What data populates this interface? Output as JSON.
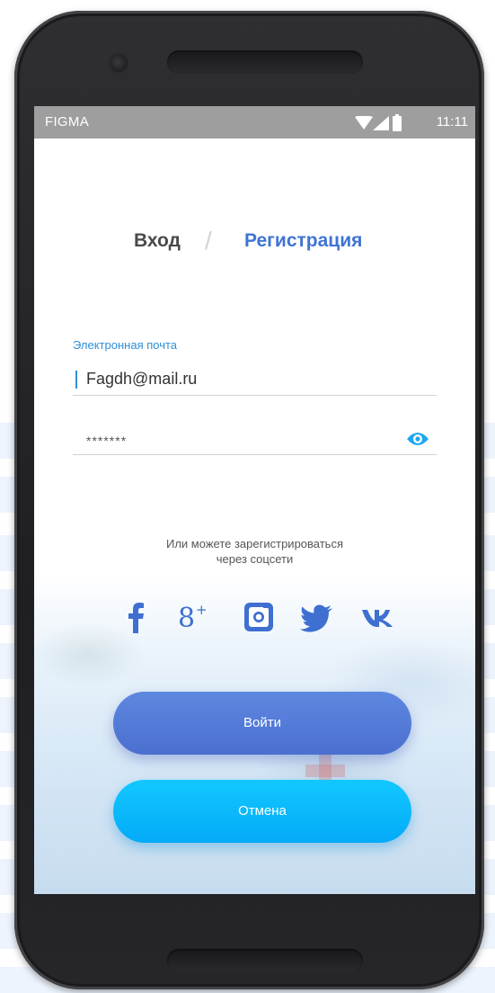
{
  "status_bar": {
    "app_name": "FIGMA",
    "time": "11:11"
  },
  "tabs": {
    "login": "Вход",
    "separator": "/",
    "register": "Регистрация"
  },
  "form": {
    "email_label": "Электронная почта",
    "email_value": "Fagdh@mail.ru",
    "password_value": "*******"
  },
  "social": {
    "text_line1": "Или можете зарегистрироваться",
    "text_line2": "через соцсети",
    "icons": [
      "facebook-icon",
      "google-plus-icon",
      "instagram-icon",
      "twitter-icon",
      "vk-icon"
    ]
  },
  "buttons": {
    "login": "Войти",
    "cancel": "Отмена"
  },
  "colors": {
    "accent": "#3f74d3",
    "label": "#2f8fd6",
    "login_button": "#4b6fd0",
    "cancel_button": "#04aaf7",
    "status_bar": "#9e9e9e"
  }
}
